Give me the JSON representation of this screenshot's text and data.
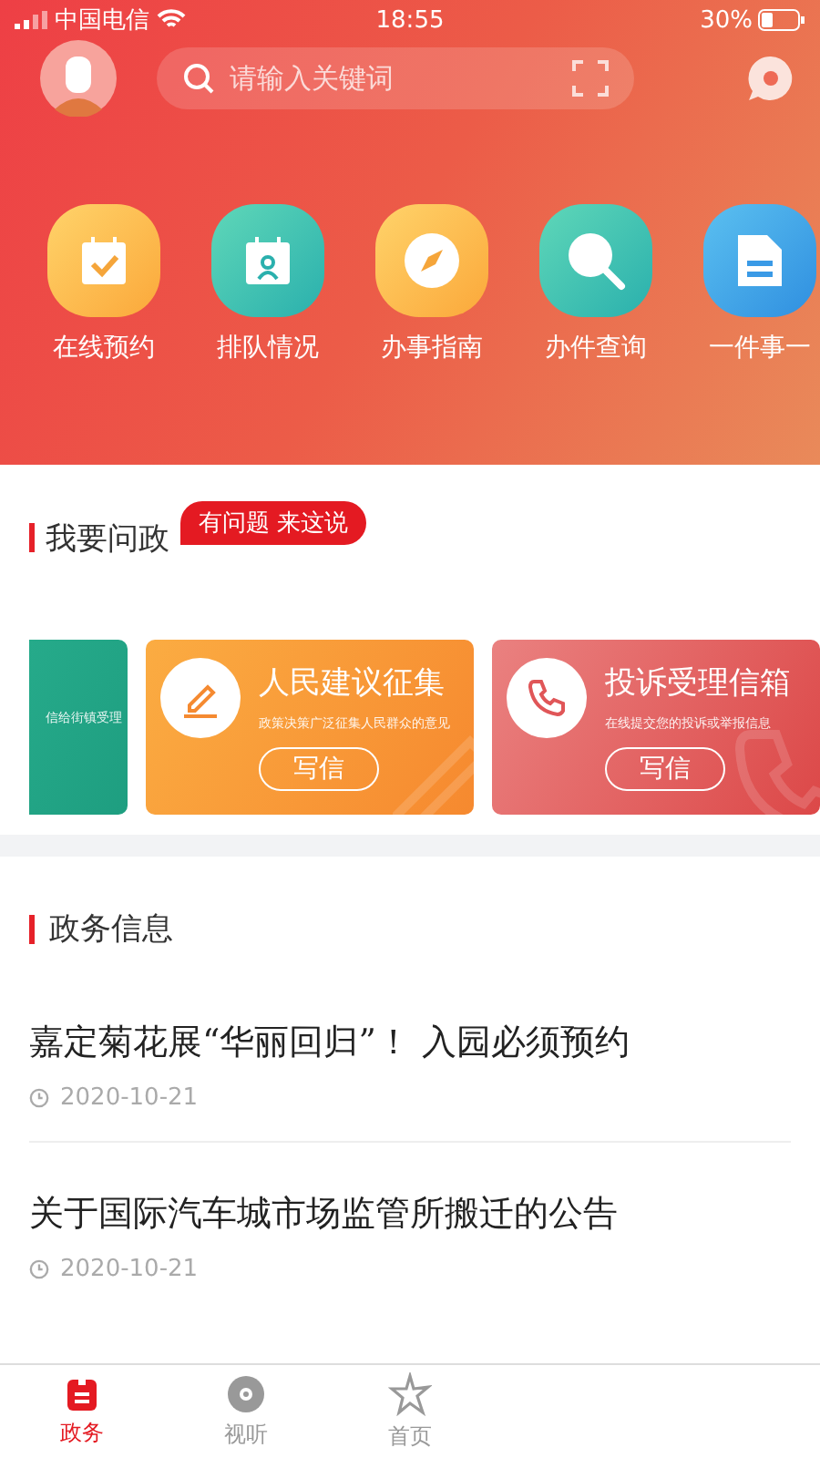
{
  "status_bar": {
    "carrier": "中国电信",
    "time": "18:55",
    "battery": "30%"
  },
  "search": {
    "placeholder": "请输入关键词"
  },
  "services": [
    {
      "label": "在线预约",
      "kind": "calendar-check"
    },
    {
      "label": "排队情况",
      "kind": "calendar-person"
    },
    {
      "label": "办事指南",
      "kind": "compass"
    },
    {
      "label": "办件查询",
      "kind": "search"
    },
    {
      "label": "一件事一",
      "kind": "document"
    }
  ],
  "ask_section": {
    "title": "我要问政",
    "badge": "有问题 来这说"
  },
  "cards": [
    {
      "kind": "street",
      "description": "信给街镇受理"
    },
    {
      "kind": "suggestion",
      "title": "人民建议征集",
      "description": "政策决策广泛征集人民群众的意见",
      "button": "写信"
    },
    {
      "kind": "complaint",
      "title": "投诉受理信箱",
      "description": "在线提交您的投诉或举报信息",
      "button": "写信"
    }
  ],
  "news": {
    "title": "政务信息",
    "items": [
      {
        "title": "嘉定菊花展“华丽回归”！ 入园必须预约",
        "date": "2020-10-21"
      },
      {
        "title": "关于国际汽车城市场监管所搬迁的公告",
        "date": "2020-10-21"
      }
    ]
  },
  "tabs": [
    {
      "label": "政务",
      "selected": true,
      "kind": "document"
    },
    {
      "label": "视听",
      "selected": false,
      "kind": "disc"
    },
    {
      "label": "首页",
      "selected": false,
      "kind": "star"
    }
  ]
}
